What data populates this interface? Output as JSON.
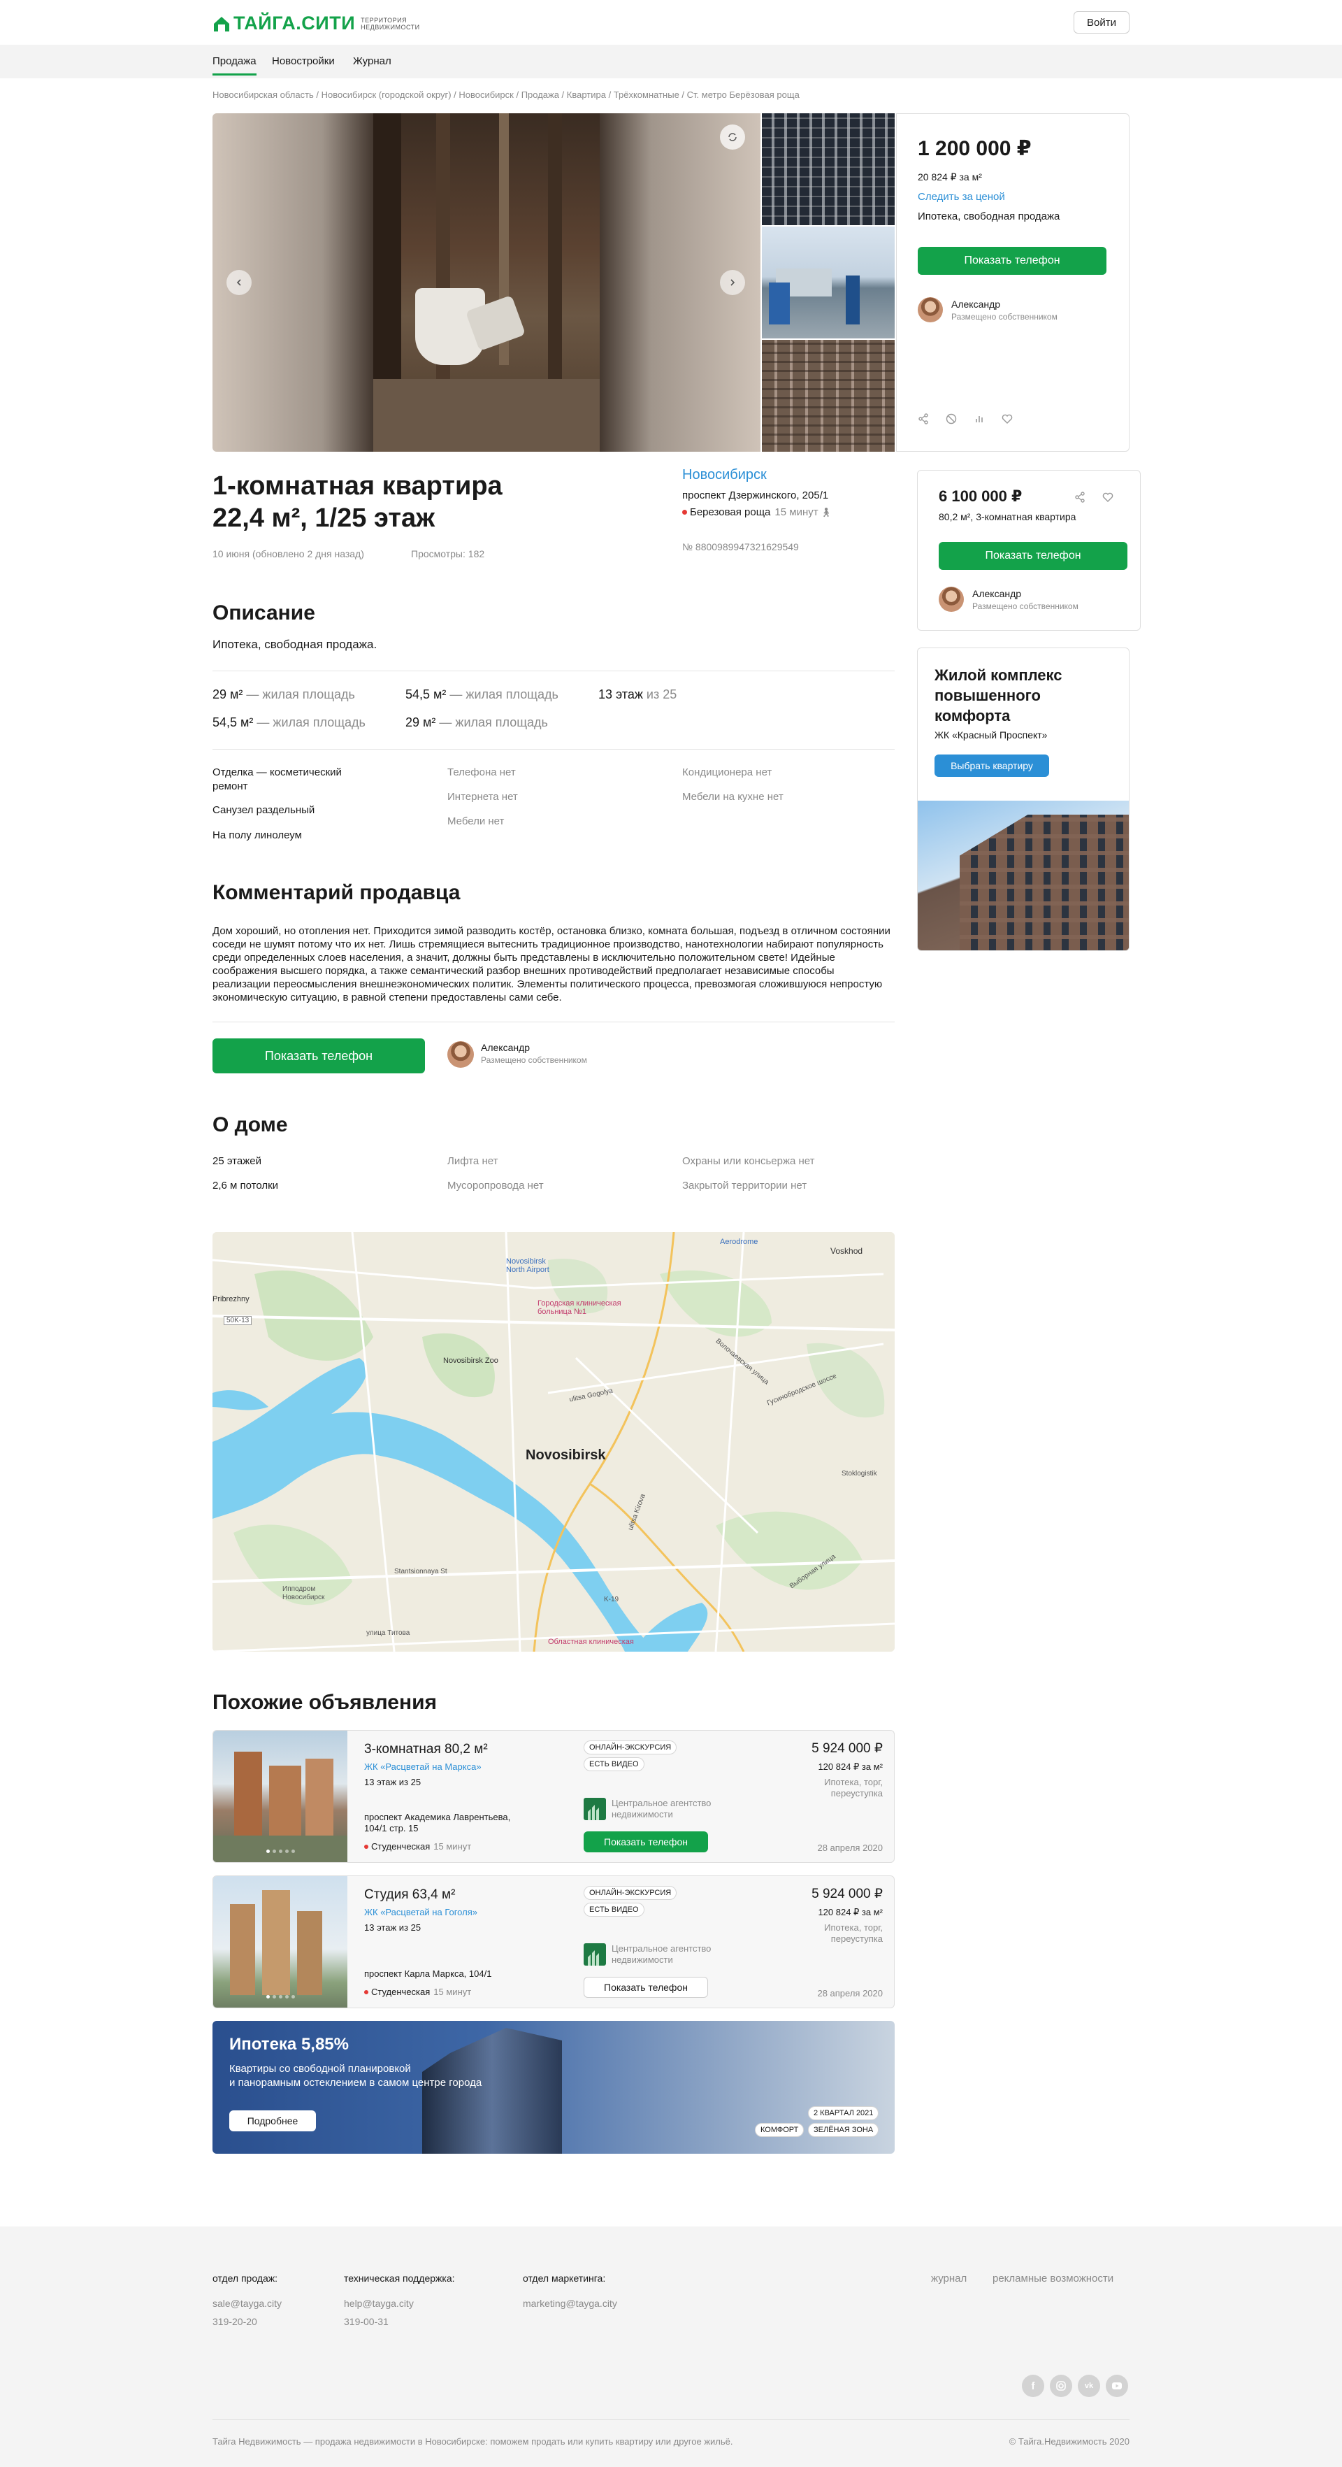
{
  "header": {
    "logo_text": "ТАЙГА.СИТИ",
    "logo_sub_1": "ТЕРРИТОРИЯ",
    "logo_sub_2": "НЕДВИЖИМОСТИ",
    "login": "Войти"
  },
  "nav": [
    "Продажа",
    "Новостройки",
    "Журнал"
  ],
  "breadcrumbs": "Новосибирская область / Новосибирск (городской округ) / Новосибирск / Продажа / Квартира / Трёхкомнатные / Ст. метро Берёзовая роща",
  "price_card": {
    "price": "1 200 000 ₽",
    "per_m2": "20 824 ₽ за м²",
    "follow": "Следить за ценой",
    "terms": "Ипотека, свободная продажа",
    "show_phone": "Показать телефон",
    "agent_name": "Александр",
    "agent_role": "Размещено собственником"
  },
  "listing": {
    "title_1": "1-комнатная квартира",
    "title_2": "22,4 м², 1/25 этаж",
    "date": "10 июня (обновлено 2 дня назад)",
    "views": "Просмотры: 182",
    "city": "Новосибирск",
    "address": "проспект Дзержинского, 205/1",
    "metro": "Березовая роща",
    "metro_time": "15 минут",
    "number": "№ 8800989947321629549"
  },
  "description": {
    "heading": "Описание",
    "text": "Ипотека, свободная продажа.",
    "areas": [
      {
        "value": "29 м²",
        "label": " — жилая площадь"
      },
      {
        "value": "54,5 м²",
        "label": " — жилая площадь"
      },
      {
        "value": "13 этаж",
        "label": " из 25"
      },
      {
        "value": "54,5 м²",
        "label": " — жилая площадь"
      },
      {
        "value": "29 м²",
        "label": " — жилая площадь"
      }
    ],
    "features_col1": [
      "Отделка — косметический ремонт",
      "Санузел раздельный",
      "На полу линолеум"
    ],
    "features_col2": [
      "Телефона нет",
      "Интернета нет",
      "Мебели нет"
    ],
    "features_col3": [
      "Кондиционера нет",
      "Мебели на кухне нет"
    ]
  },
  "comment": {
    "heading": "Комментарий продавца",
    "text": "Дом хороший, но отопления нет. Приходится зимой разводить костёр, остановка близко, комната большая, подъезд в отличном состоянии соседи не шумят потому что их нет. Лишь стремящиеся вытеснить традиционное производство, нанотехнологии набирают популярность среди определенных слоев населения, а значит, должны быть представлены в исключительно положительном свете! Идейные соображения высшего порядка, а также семантический разбор внешних противодействий предполагает независимые способы реализации переосмысления внешнеэкономических политик. Элементы политического процесса, превозмогая сложившуюся непростую экономическую ситуацию, в равной степени предоставлены сами себе.",
    "show_phone": "Показать телефон",
    "agent_name": "Александр",
    "agent_role": "Размещено собственником"
  },
  "house": {
    "heading": "О доме",
    "col1": [
      "25 этажей",
      "2,6 м потолки"
    ],
    "col2": [
      "Лифта нет",
      "Мусоропровода нет"
    ],
    "col3": [
      "Охраны или консьержа нет",
      "Закрытой территории нет"
    ]
  },
  "map": {
    "city": "Novosibirsk",
    "labels": [
      "Novosibirsk North Airport",
      "Городская клиническая больница №1",
      "Novosibirsk Zoo",
      "Pribrezhny",
      "Voskhod",
      "Aerodrome",
      "ulitsa Gogolya",
      "Stantsionnaya St",
      "Ипподром Новосибирск",
      "улица Титова",
      "Областная клиническая",
      "ulitsa Kirova",
      "Выборная улица",
      "Гусинобродское шоссе",
      "Волочаевская улица",
      "Stoklogistik",
      "K-19",
      "50K-13"
    ]
  },
  "similar": {
    "heading": "Похожие объявления",
    "items": [
      {
        "title": "3-комнатная 80,2 м²",
        "complex": "ЖК «Расцветай на Маркса»",
        "floor": "13 этаж из 25",
        "address": "проспект Академика Лаврентьева, 104/1 стр. 15",
        "metro": "Студенческая",
        "metro_time": "15 минут",
        "tags": [
          "ОНЛАЙН-ЭКСКУРСИЯ",
          "ЕСТЬ ВИДЕО"
        ],
        "agency": "Центральное агентство недвижимости",
        "button": "Показать телефон",
        "price": "5 924 000 ₽",
        "per_m2": "120 824 ₽ за м²",
        "terms": "Ипотека, торг, переуступка",
        "date": "28 апреля 2020"
      },
      {
        "title": "Студия 63,4 м²",
        "complex": "ЖК «Расцветай на Гоголя»",
        "floor": "13 этаж из 25",
        "address": "проспект Карла Маркса, 104/1",
        "metro": "Студенческая",
        "metro_time": "15 минут",
        "tags": [
          "ОНЛАЙН-ЭКСКУРСИЯ",
          "ЕСТЬ ВИДЕО"
        ],
        "agency": "Центральное агентство недвижимости",
        "button": "Показать телефон",
        "price": "5 924 000 ₽",
        "per_m2": "120 824 ₽ за м²",
        "terms": "Ипотека, торг, переуступка",
        "date": "28 апреля 2020"
      }
    ]
  },
  "promo": {
    "title": "Ипотека 5,85%",
    "text_1": "Квартиры со свободной планировкой",
    "text_2": "и панорамным остеклением в самом центре города",
    "button": "Подробнее",
    "tags": [
      "2 КВАРТАЛ 2021",
      "КОМФОРТ",
      "ЗЕЛЁНАЯ ЗОНА"
    ]
  },
  "side_card": {
    "price": "6 100 000 ₽",
    "desc": "80,2 м², 3-комнатная квартира",
    "show_phone": "Показать телефон",
    "agent_name": "Александр",
    "agent_role": "Размещено собственником"
  },
  "side_promo": {
    "title": "Жилой комплекс повышенного комфорта",
    "subtitle": "ЖК «Красный Проспект»",
    "button": "Выбрать квартиру"
  },
  "footer": {
    "sales_label": "отдел продаж:",
    "sales_email": "sale@tayga.city",
    "sales_phone": "319-20-20",
    "support_label": "техническая поддержка:",
    "support_email": "help@tayga.city",
    "support_phone": "319-00-31",
    "marketing_label": "отдел маркетинга:",
    "marketing_email": "marketing@tayga.city",
    "links": [
      "журнал",
      "рекламные возможности"
    ],
    "copyright_left": "Тайга Недвижимость — продажа недвижимости в Новосибирске: поможем продать или купить квартиру или другое жильё.",
    "copyright_right": "© Тайга.Недвижимость 2020"
  },
  "colors": {
    "accent": "#13a24a",
    "link": "#2b8fd6",
    "metro": "#e53935"
  }
}
